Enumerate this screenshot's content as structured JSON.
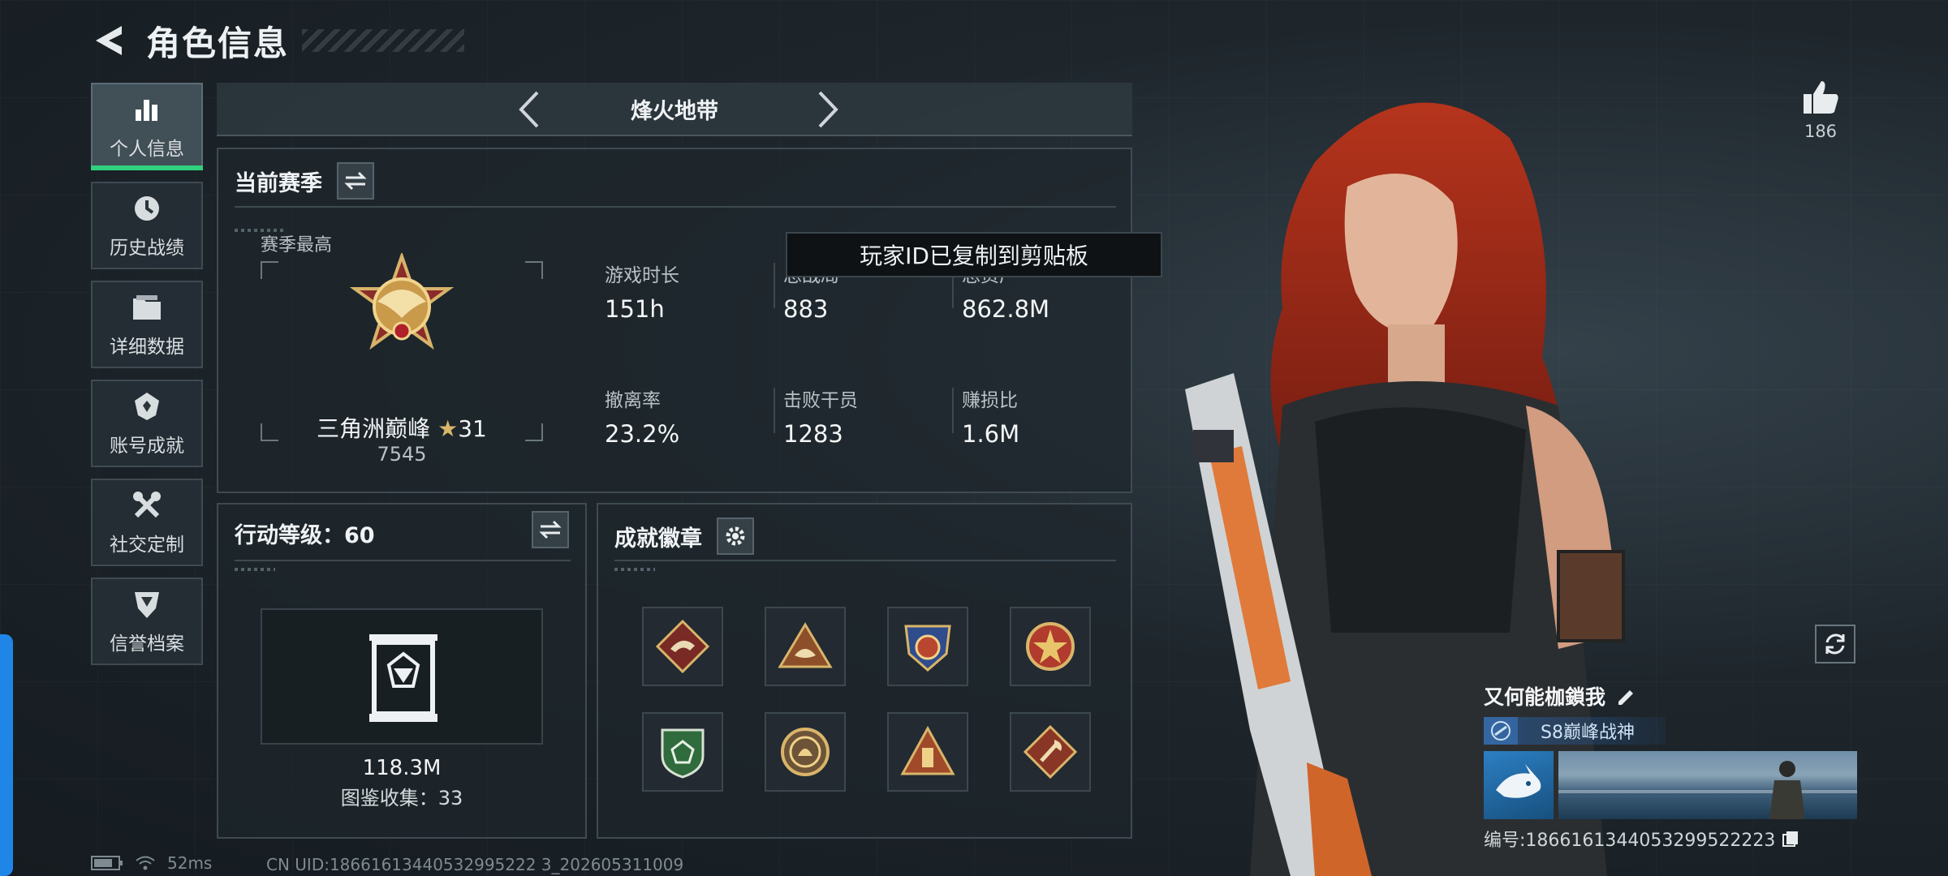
{
  "header": {
    "title": "角色信息"
  },
  "sidebar": {
    "items": [
      {
        "label": "个人信息",
        "icon": "bar-chart-icon",
        "active": true
      },
      {
        "label": "历史战绩",
        "icon": "history-icon",
        "active": false
      },
      {
        "label": "详细数据",
        "icon": "folder-icon",
        "active": false
      },
      {
        "label": "账号成就",
        "icon": "achievement-icon",
        "active": false
      },
      {
        "label": "社交定制",
        "icon": "tools-icon",
        "active": false
      },
      {
        "label": "信誉档案",
        "icon": "shield-icon",
        "active": false
      }
    ]
  },
  "mode": {
    "title": "烽火地带"
  },
  "season": {
    "title": "当前赛季",
    "best_label": "赛季最高",
    "rank_name": "三角洲巅峰",
    "rank_stars": "31",
    "rank_score": "7545",
    "stats": [
      {
        "label": "游戏时长",
        "value": "151h"
      },
      {
        "label": "总战局",
        "value": "883"
      },
      {
        "label": "总资产",
        "value": "862.8M"
      },
      {
        "label": "撤离率",
        "value": "23.2%"
      },
      {
        "label": "击败干员",
        "value": "1283"
      },
      {
        "label": "赚损比",
        "value": "1.6M"
      }
    ]
  },
  "toast": {
    "text": "玩家ID已复制到剪贴板"
  },
  "level": {
    "title": "行动等级：60",
    "value": "118.3M",
    "collection": "图鉴收集：33"
  },
  "badges": {
    "title": "成就徽章",
    "items": [
      "lizard-badge-icon",
      "fish-badge-icon",
      "medal-badge-icon",
      "star-badge-icon",
      "green-shield-badge-icon",
      "coin-badge-icon",
      "tower-badge-icon",
      "axe-badge-icon"
    ]
  },
  "likes": {
    "count": "186"
  },
  "player": {
    "name": "又何能枷鎖我",
    "title": "S8巅峰战神",
    "id": "编号:1866161344053299522223"
  },
  "footer": {
    "ping": "52ms",
    "uid": "CN UID:18661613440532995222 3_202605311009"
  },
  "colors": {
    "accent_green": "#2fd17e",
    "left_tab_blue": "#1f86e8"
  }
}
